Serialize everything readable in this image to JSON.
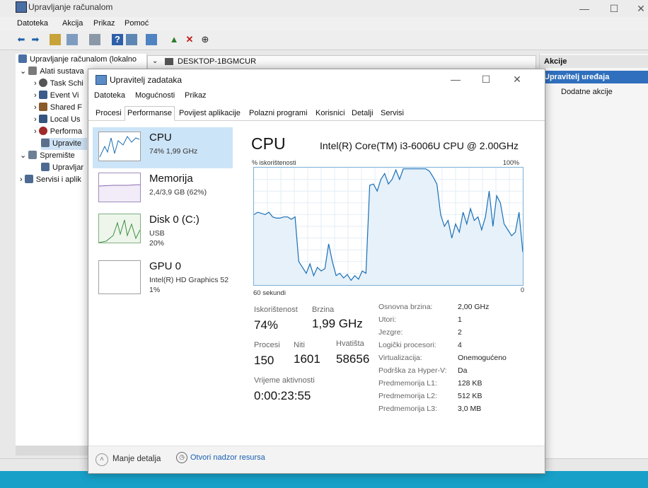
{
  "cm": {
    "title": "Upravljanje računalom",
    "menu": [
      "Datoteka",
      "Akcija",
      "Prikaz",
      "Pomoć"
    ],
    "tree": [
      {
        "label": "Upravljanje računalom (lokalno",
        "icon": "computer-management-icon"
      },
      {
        "label": "Alati sustava",
        "icon": "tools-icon"
      },
      {
        "label": "Task Schi",
        "icon": "clock-icon"
      },
      {
        "label": "Event Vi",
        "icon": "event-viewer-icon"
      },
      {
        "label": "Shared F",
        "icon": "shared-folder-icon"
      },
      {
        "label": "Local Us",
        "icon": "users-icon"
      },
      {
        "label": "Performa",
        "icon": "performance-icon"
      },
      {
        "label": "Upravite",
        "icon": "device-manager-icon"
      },
      {
        "label": "Spremište",
        "icon": "storage-icon"
      },
      {
        "label": "Upravljar",
        "icon": "disk-icon"
      },
      {
        "label": "Servisi i aplik",
        "icon": "services-icon"
      }
    ],
    "address": "DESKTOP-1BGMCUR",
    "actions": {
      "header": "Akcije",
      "selected": "Upravitelj uređaja",
      "more": "Dodatne akcije"
    }
  },
  "tm": {
    "title": "Upravitelj zadataka",
    "menu": [
      "Datoteka",
      "Mogućnosti",
      "Prikaz"
    ],
    "tabs": [
      "Procesi",
      "Performanse",
      "Povijest aplikacije",
      "Polazni programi",
      "Korisnici",
      "Detalji",
      "Servisi"
    ],
    "active_tab": "Performanse",
    "perf_items": [
      {
        "name": "CPU",
        "sub": "74%  1,99 GHz",
        "sub2": ""
      },
      {
        "name": "Memorija",
        "sub": "2,4/3,9 GB (62%)",
        "sub2": ""
      },
      {
        "name": "Disk 0 (C:)",
        "sub": "USB",
        "sub2": "20%"
      },
      {
        "name": "GPU 0",
        "sub": "Intel(R) HD Graphics 52",
        "sub2": "1%"
      }
    ],
    "cpu": {
      "title": "CPU",
      "model": "Intel(R) Core(TM) i3-6006U CPU @ 2.00GHz",
      "graph_ylabel": "% iskorištenosti",
      "graph_ymax": "100%",
      "graph_xlabel": "60 sekundi",
      "graph_xmin": "0",
      "stats": {
        "util_label": "Iskorištenost",
        "util_value": "74%",
        "speed_label": "Brzina",
        "speed_value": "1,99 GHz",
        "proc_label": "Procesi",
        "proc_value": "150",
        "threads_label": "Niti",
        "threads_value": "1601",
        "handles_label": "Hvatišta",
        "handles_value": "58656",
        "uptime_label": "Vrijeme aktivnosti",
        "uptime_value": "0:00:23:55"
      },
      "specs": [
        {
          "key": "Osnovna brzina:",
          "val": "2,00 GHz"
        },
        {
          "key": "Utori:",
          "val": "1"
        },
        {
          "key": "Jezgre:",
          "val": "2"
        },
        {
          "key": "Logički procesori:",
          "val": "4"
        },
        {
          "key": "Virtualizacija:",
          "val": "Onemogućeno"
        },
        {
          "key": "Podrška za Hyper-V:",
          "val": "Da"
        },
        {
          "key": "Predmemorija L1:",
          "val": "128 KB"
        },
        {
          "key": "Predmemorija L2:",
          "val": "512 KB"
        },
        {
          "key": "Predmemorija L3:",
          "val": "3,0 MB"
        }
      ],
      "history": [
        60,
        62,
        61,
        60,
        62,
        58,
        57,
        57,
        58,
        58,
        56,
        58,
        20,
        15,
        10,
        18,
        8,
        15,
        12,
        14,
        35,
        20,
        8,
        10,
        6,
        9,
        4,
        8,
        5,
        12,
        10,
        85,
        86,
        80,
        90,
        95,
        86,
        90,
        98,
        90,
        99,
        99,
        99,
        99,
        99,
        99,
        99,
        97,
        92,
        86,
        60,
        50,
        55,
        40,
        52,
        45,
        62,
        52,
        65,
        55,
        58,
        47,
        58,
        80,
        50,
        76,
        70,
        52,
        47,
        42,
        45,
        62,
        28
      ]
    },
    "footer": {
      "fewer": "Manje detalja",
      "resmon": "Otvori nadzor resursa"
    },
    "colors": {
      "accent": "#1178c5",
      "graph_fill": "#e6f1fa",
      "graph_line": "#1a6fb5",
      "selected_bg": "#cce4f7"
    }
  }
}
